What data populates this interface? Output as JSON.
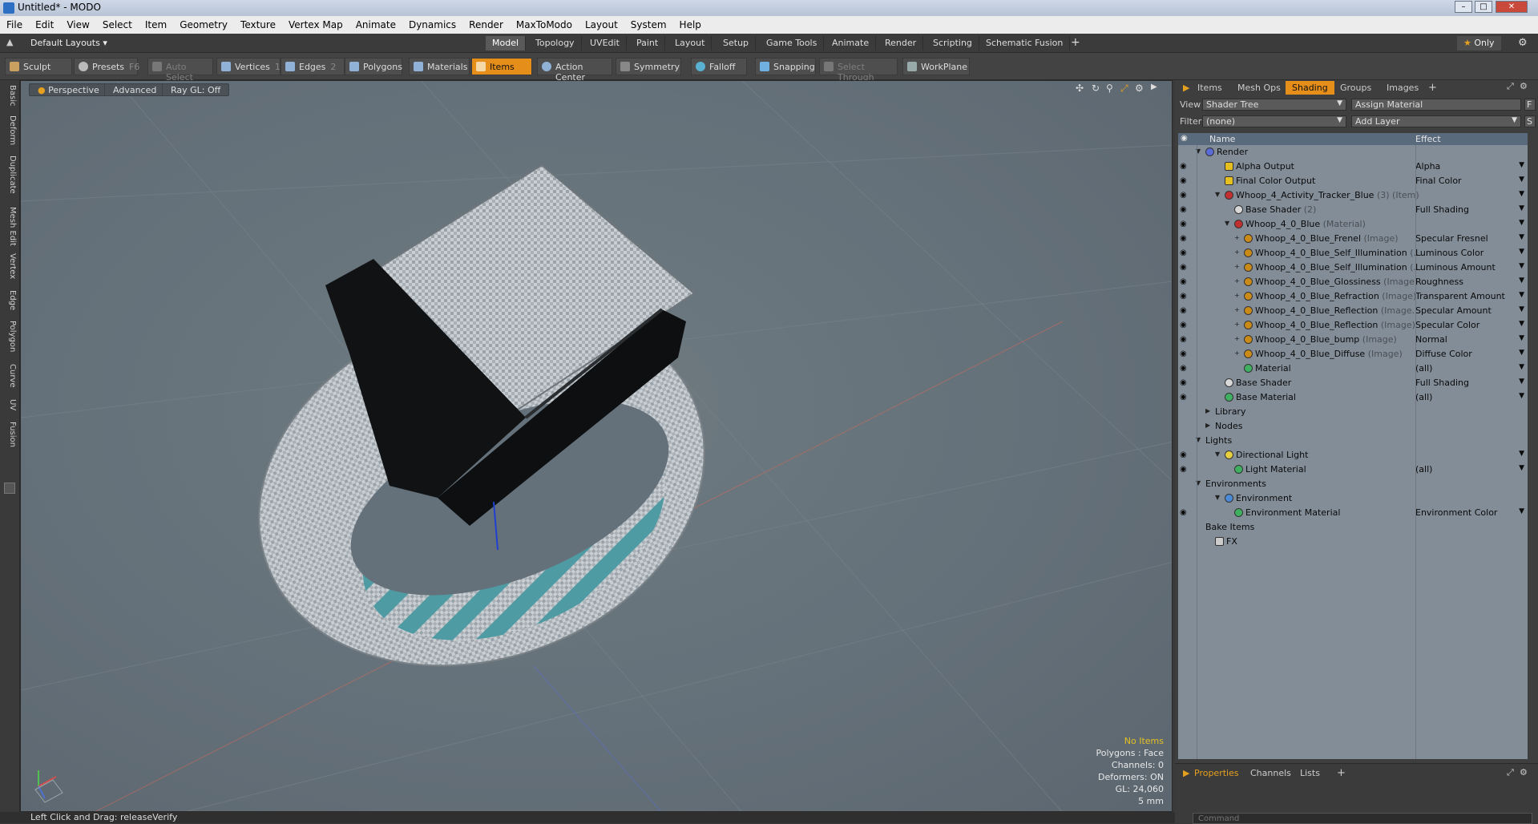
{
  "window": {
    "title": "Untitled* - MODO"
  },
  "menu": [
    "File",
    "Edit",
    "View",
    "Select",
    "Item",
    "Geometry",
    "Texture",
    "Vertex Map",
    "Animate",
    "Dynamics",
    "Render",
    "MaxToModo",
    "Layout",
    "System",
    "Help"
  ],
  "layout": {
    "preset": "Default Layouts",
    "tabs": [
      "Model",
      "Topology",
      "UVEdit",
      "Paint",
      "Layout",
      "Setup",
      "Game Tools",
      "Animate",
      "Render",
      "Scripting",
      "Schematic Fusion"
    ],
    "active_tab": "Model",
    "plus": "+",
    "only_label": "Only"
  },
  "toolbar": {
    "sculpt": "Sculpt",
    "presets": "Presets",
    "presets_key": "F6",
    "auto_select": "Auto Select",
    "vertices": "Vertices",
    "vertices_key": "1",
    "edges": "Edges",
    "edges_key": "2",
    "polygons": "Polygons",
    "materials": "Materials",
    "items": "Items",
    "action_center": "Action Center",
    "symmetry": "Symmetry",
    "falloff": "Falloff",
    "snapping": "Snapping",
    "select_through": "Select Through",
    "workplane": "WorkPlane"
  },
  "left_tabs": [
    "Basic",
    "Deform",
    "Duplicate",
    "Mesh Edit",
    "Vertex",
    "Edge",
    "Polygon",
    "Curve",
    "UV",
    "Fusion"
  ],
  "viewport": {
    "perspective": "Perspective",
    "advanced": "Advanced",
    "raygl": "Ray GL: Off",
    "stats": {
      "items": "No Items",
      "polygons": "Polygons : Face",
      "channels": "Channels: 0",
      "deformers": "Deformers: ON",
      "gl": "GL: 24,060",
      "scale": "5 mm"
    }
  },
  "right_panel": {
    "tabs": [
      "Items",
      "Mesh Ops",
      "Shading",
      "Groups",
      "Images"
    ],
    "active_tab": "Shading",
    "plus": "+",
    "view_label": "View",
    "view_value": "Shader Tree",
    "assign_material": "Assign Material",
    "filter_label": "Filter",
    "filter_value": "(none)",
    "add_layer": "Add Layer",
    "col_name": "Name",
    "col_effect": "Effect",
    "f_btn": "F",
    "s_btn": "S",
    "tree": [
      {
        "name": "Render",
        "sub": "",
        "effect": "",
        "indent": 0,
        "eye": false,
        "toggle": "down",
        "glyph": "#5a6ad6"
      },
      {
        "name": "Alpha Output",
        "sub": "",
        "effect": "Alpha",
        "indent": 2,
        "eye": true,
        "toggle": "",
        "glyph": "#e6c020",
        "sq": true
      },
      {
        "name": "Final Color Output",
        "sub": "",
        "effect": "Final Color",
        "indent": 2,
        "eye": true,
        "toggle": "",
        "glyph": "#e6c020",
        "sq": true
      },
      {
        "name": "Whoop_4_Activity_Tracker_Blue",
        "sub": " (3) (Item)",
        "effect": "",
        "indent": 2,
        "eye": true,
        "toggle": "down",
        "glyph": "#c03030"
      },
      {
        "name": "Base Shader",
        "sub": " (2)",
        "effect": "Full Shading",
        "indent": 3,
        "eye": true,
        "toggle": "",
        "glyph": "#d8d8d8"
      },
      {
        "name": "Whoop_4_0_Blue",
        "sub": " (Material)",
        "effect": "",
        "indent": 3,
        "eye": true,
        "toggle": "down",
        "glyph": "#c03030"
      },
      {
        "name": "Whoop_4_0_Blue_Frenel",
        "sub": " (Image)",
        "effect": "Specular Fresnel",
        "indent": 4,
        "eye": true,
        "toggle": "plus",
        "glyph": "#c98a18"
      },
      {
        "name": "Whoop_4_0_Blue_Self_Illumination",
        "sub": " (…",
        "effect": "Luminous Color",
        "indent": 4,
        "eye": true,
        "toggle": "plus",
        "glyph": "#c98a18"
      },
      {
        "name": "Whoop_4_0_Blue_Self_Illumination",
        "sub": " (…",
        "effect": "Luminous Amount",
        "indent": 4,
        "eye": true,
        "toggle": "plus",
        "glyph": "#c98a18"
      },
      {
        "name": "Whoop_4_0_Blue_Glossiness",
        "sub": " (Image)",
        "effect": "Roughness",
        "indent": 4,
        "eye": true,
        "toggle": "plus",
        "glyph": "#c98a18"
      },
      {
        "name": "Whoop_4_0_Blue_Refraction",
        "sub": " (Image)",
        "effect": "Transparent Amount",
        "indent": 4,
        "eye": true,
        "toggle": "plus",
        "glyph": "#c98a18"
      },
      {
        "name": "Whoop_4_0_Blue_Reflection",
        "sub": " (Image…",
        "effect": "Specular Amount",
        "indent": 4,
        "eye": true,
        "toggle": "plus",
        "glyph": "#c98a18"
      },
      {
        "name": "Whoop_4_0_Blue_Reflection",
        "sub": " (Image)",
        "effect": "Specular Color",
        "indent": 4,
        "eye": true,
        "toggle": "plus",
        "glyph": "#c98a18"
      },
      {
        "name": "Whoop_4_0_Blue_bump",
        "sub": " (Image)",
        "effect": "Normal",
        "indent": 4,
        "eye": true,
        "toggle": "plus",
        "glyph": "#c98a18"
      },
      {
        "name": "Whoop_4_0_Blue_Diffuse",
        "sub": " (Image)",
        "effect": "Diffuse Color",
        "indent": 4,
        "eye": true,
        "toggle": "plus",
        "glyph": "#c98a18"
      },
      {
        "name": "Material",
        "sub": "",
        "effect": "(all)",
        "indent": 4,
        "eye": true,
        "toggle": "",
        "glyph": "#3fb060"
      },
      {
        "name": "Base Shader",
        "sub": "",
        "effect": "Full Shading",
        "indent": 2,
        "eye": true,
        "toggle": "",
        "glyph": "#d8d8d8"
      },
      {
        "name": "Base Material",
        "sub": "",
        "effect": "(all)",
        "indent": 2,
        "eye": true,
        "toggle": "",
        "glyph": "#3fb060"
      },
      {
        "name": "Library",
        "sub": "",
        "effect": "",
        "indent": 1,
        "eye": false,
        "toggle": "right",
        "glyph": ""
      },
      {
        "name": "Nodes",
        "sub": "",
        "effect": "",
        "indent": 1,
        "eye": false,
        "toggle": "right",
        "glyph": ""
      },
      {
        "name": "Lights",
        "sub": "",
        "effect": "",
        "indent": 0,
        "eye": false,
        "toggle": "down",
        "glyph": ""
      },
      {
        "name": "Directional Light",
        "sub": "",
        "effect": "",
        "indent": 2,
        "eye": true,
        "toggle": "down",
        "glyph": "#e6d040"
      },
      {
        "name": "Light Material",
        "sub": "",
        "effect": "(all)",
        "indent": 3,
        "eye": true,
        "toggle": "",
        "glyph": "#3fb060"
      },
      {
        "name": "Environments",
        "sub": "",
        "effect": "",
        "indent": 0,
        "eye": false,
        "toggle": "down",
        "glyph": ""
      },
      {
        "name": "Environment",
        "sub": "",
        "effect": "",
        "indent": 2,
        "eye": false,
        "toggle": "down",
        "glyph": "#4a8ad6"
      },
      {
        "name": "Environment Material",
        "sub": "",
        "effect": "Environment Color",
        "indent": 3,
        "eye": true,
        "toggle": "",
        "glyph": "#3fb060"
      },
      {
        "name": "Bake Items",
        "sub": "",
        "effect": "",
        "indent": 0,
        "eye": false,
        "toggle": "",
        "glyph": ""
      },
      {
        "name": "FX",
        "sub": "",
        "effect": "",
        "indent": 1,
        "eye": false,
        "toggle": "",
        "glyph": "#cccccc",
        "sq": true
      }
    ]
  },
  "bottom_panel": {
    "tabs": [
      "Properties",
      "Channels",
      "Lists"
    ],
    "active_tab": "Properties",
    "plus": "+",
    "command_placeholder": "Command"
  },
  "status": {
    "text": "Left Click and Drag:  releaseVerify"
  }
}
